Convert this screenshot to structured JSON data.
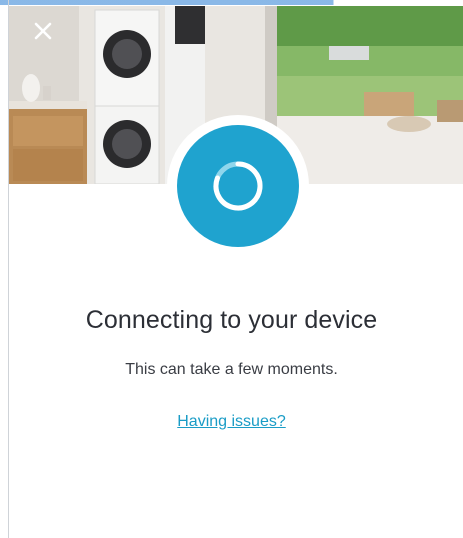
{
  "header": {
    "close_icon": "close-icon"
  },
  "status": {
    "title": "Connecting to your device",
    "subtitle": "This can take a few moments.",
    "help_link": "Having issues?",
    "spinner_icon": "loading-spinner-icon"
  },
  "colors": {
    "accent": "#1fa3cf",
    "title_text": "#2c2f36",
    "link": "#1a9cc6"
  }
}
